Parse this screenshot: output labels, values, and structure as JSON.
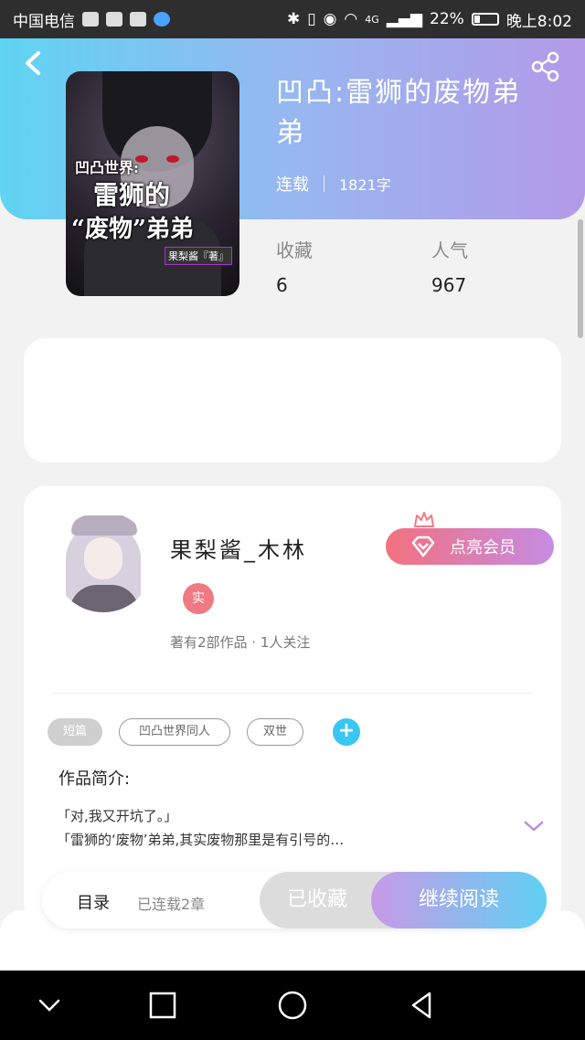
{
  "status_bar": {
    "carrier": "中国电信",
    "battery": "22%",
    "network": "4G",
    "time": "晚上8:02"
  },
  "header": {
    "back_icon": "back-arrow-icon",
    "share_icon": "share-icon",
    "gradient_colors": [
      "#5fd4f3",
      "#b39ae8"
    ]
  },
  "cover": {
    "line1": "凹凸世界:",
    "line2": "雷狮的",
    "line3": "“废物”弟弟",
    "signature": "果梨酱『著』"
  },
  "book": {
    "title": "凹凸:雷狮的废物弟弟",
    "status": "连载",
    "words": "1821字"
  },
  "stats": {
    "favorites_label": "收藏",
    "favorites_value": "6",
    "popularity_label": "人气",
    "popularity_value": "967"
  },
  "author": {
    "name": "果梨酱_木林",
    "verified_badge": "实",
    "summary": "著有2部作品 · 1人关注",
    "vip_button": "点亮会员"
  },
  "tags": [
    "短篇",
    "凹凸世界同人",
    "双世"
  ],
  "intro": {
    "label": "作品简介:",
    "lines": [
      "「对,我又开坑了。」",
      "「雷狮的‘废物’弟弟,其实废物那里是有引号的…"
    ]
  },
  "actions": {
    "toc_label": "目录",
    "toc_status": "已连载2章",
    "collected_label": "已收藏",
    "read_label": "继续阅读"
  },
  "nav": {
    "icons": [
      "chevron-down-icon",
      "square-icon",
      "circle-icon",
      "triangle-back-icon"
    ]
  }
}
